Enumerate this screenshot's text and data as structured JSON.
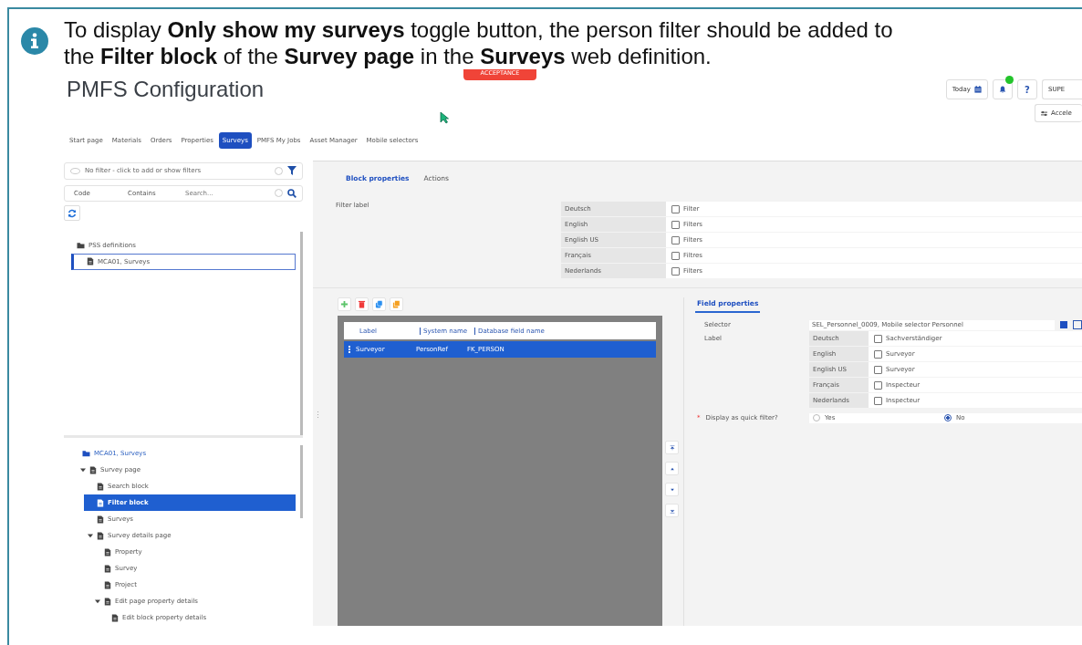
{
  "note": {
    "text": "To display **Only show my surveys** toggle button, the person filter should be added to the **Filter block** of the **Survey page** in the **Surveys** web definition."
  },
  "app": {
    "title": "PMFS Configuration",
    "environment": "ACCEPTANCE",
    "header": {
      "today": "Today",
      "notification_dot": true,
      "help": "?",
      "user": "SUPE",
      "accelerator": "Accele"
    },
    "tabs": [
      {
        "label": "Start page",
        "selected": false
      },
      {
        "label": "Materials",
        "selected": false
      },
      {
        "label": "Orders",
        "selected": false
      },
      {
        "label": "Properties",
        "selected": false
      },
      {
        "label": "Surveys",
        "selected": true
      },
      {
        "label": "PMFS My Jobs",
        "selected": false
      },
      {
        "label": "Asset Manager",
        "selected": false
      },
      {
        "label": "Mobile selectors",
        "selected": false
      }
    ],
    "left_panel": {
      "filter_placeholder": "No filter - click to add or show filters",
      "search": {
        "field": "Code",
        "operator": "Contains",
        "placeholder": "Search..."
      },
      "definitions_tree": [
        {
          "label": "PSS definitions",
          "kind": "folder",
          "selected": false,
          "children": [
            {
              "label": "MCA01, Surveys",
              "kind": "document",
              "selected": true
            }
          ]
        }
      ],
      "structure_tree": [
        {
          "label": "MCA01, Surveys",
          "kind": "folder",
          "selected": false,
          "children": [
            {
              "label": "Survey page",
              "kind": "document",
              "selected": false,
              "expanded": true,
              "children": [
                {
                  "label": "Search block",
                  "kind": "document",
                  "selected": false
                },
                {
                  "label": "Filter block",
                  "kind": "document",
                  "selected": true
                },
                {
                  "label": "Surveys",
                  "kind": "document",
                  "selected": false
                },
                {
                  "label": "Survey details page",
                  "kind": "document",
                  "selected": false,
                  "expanded": true,
                  "children": [
                    {
                      "label": "Property",
                      "kind": "document",
                      "selected": false
                    },
                    {
                      "label": "Survey",
                      "kind": "document",
                      "selected": false
                    },
                    {
                      "label": "Project",
                      "kind": "document",
                      "selected": false
                    },
                    {
                      "label": "Edit page property details",
                      "kind": "document",
                      "selected": false,
                      "expanded": true,
                      "children": [
                        {
                          "label": "Edit block property details",
                          "kind": "document",
                          "selected": false
                        }
                      ]
                    }
                  ]
                }
              ]
            }
          ]
        }
      ]
    },
    "right_panel": {
      "tabs": [
        {
          "label": "Block properties",
          "selected": true
        },
        {
          "label": "Actions",
          "selected": false
        }
      ],
      "filter_label": {
        "label": "Filter label",
        "translations": [
          {
            "language": "Deutsch",
            "value": "Filter",
            "checked": false
          },
          {
            "language": "English",
            "value": "Filters",
            "checked": false
          },
          {
            "language": "English US",
            "value": "Filters",
            "checked": false
          },
          {
            "language": "Français",
            "value": "Filtres",
            "checked": false
          },
          {
            "language": "Nederlands",
            "value": "Filters",
            "checked": false
          }
        ]
      },
      "fields_grid": {
        "columns": [
          "Label",
          "System name",
          "Database field name"
        ],
        "rows": [
          {
            "cells": [
              "Surveyor",
              "PersonRef",
              "FK_PERSON"
            ],
            "selected": true
          }
        ]
      },
      "field_properties": {
        "tab": "Field properties",
        "selector_label": "Selector",
        "selector_value": "SEL_Personnel_0009, Mobile selector Personnel",
        "label_label": "Label",
        "translations": [
          {
            "language": "Deutsch",
            "value": "Sachverständiger",
            "checked": false
          },
          {
            "language": "English",
            "value": "Surveyor",
            "checked": false
          },
          {
            "language": "English US",
            "value": "Surveyor",
            "checked": false
          },
          {
            "language": "Français",
            "value": "Inspecteur",
            "checked": false
          },
          {
            "language": "Nederlands",
            "value": "Inspecteur",
            "checked": false
          }
        ],
        "quick_filter": {
          "required_mark": "*",
          "label": "Display as quick filter?",
          "options": [
            {
              "label": "Yes",
              "selected": false
            },
            {
              "label": "No",
              "selected": true
            }
          ]
        }
      }
    }
  }
}
